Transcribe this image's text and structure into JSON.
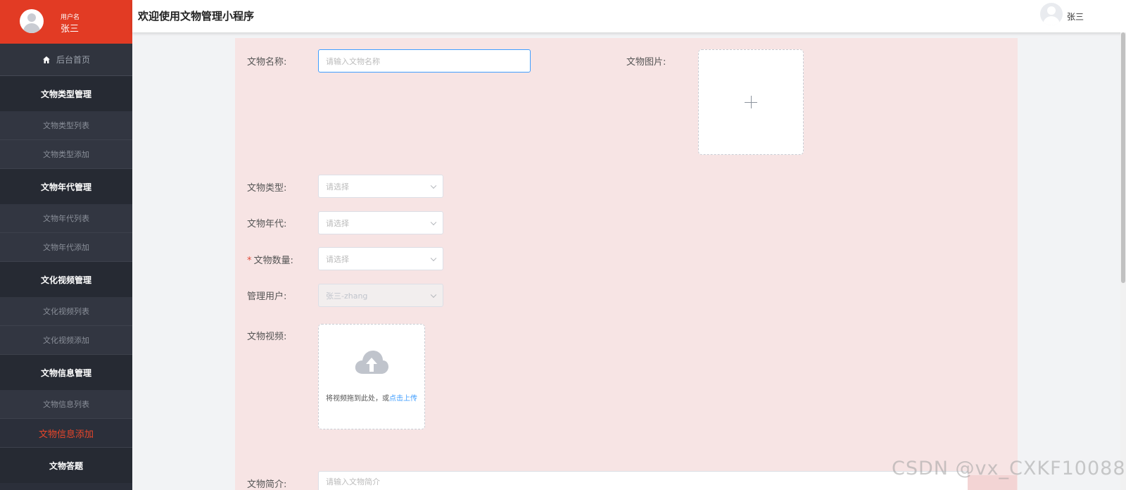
{
  "sidebar": {
    "user_label": "用户名",
    "user_name": "张三",
    "home": "后台首页",
    "groups": [
      {
        "title": "文物类型管理",
        "items": [
          "文物类型列表",
          "文物类型添加"
        ]
      },
      {
        "title": "文物年代管理",
        "items": [
          "文物年代列表",
          "文物年代添加"
        ]
      },
      {
        "title": "文化视频管理",
        "items": [
          "文化视频列表",
          "文化视频添加"
        ]
      },
      {
        "title": "文物信息管理",
        "items": [
          "文物信息列表",
          "文物信息添加"
        ]
      },
      {
        "title": "文物答题",
        "items": []
      }
    ],
    "active_item": "文物信息添加"
  },
  "header": {
    "title": "欢迎使用文物管理小程序",
    "user": "张三"
  },
  "form": {
    "name_label": "文物名称:",
    "name_placeholder": "请输入文物名称",
    "image_label": "文物图片:",
    "type_label": "文物类型:",
    "type_placeholder": "请选择",
    "era_label": "文物年代:",
    "era_placeholder": "请选择",
    "quantity_required": "*",
    "quantity_label": "文物数量:",
    "quantity_placeholder": "请选择",
    "user_label": "管理用户:",
    "user_value": "张三-zhang",
    "video_label": "文物视频:",
    "video_hint": "将视频拖到此处，或",
    "video_link": "点击上传",
    "intro_label": "文物简介:",
    "intro_placeholder": "请输入文物简介"
  },
  "watermark": "CSDN @vx_CXKF10088",
  "colors": {
    "sidebar_bg": "#2b2f3a",
    "brand_red": "#e23b24",
    "panel_bg": "#f7e4e4",
    "link_blue": "#409eff"
  }
}
